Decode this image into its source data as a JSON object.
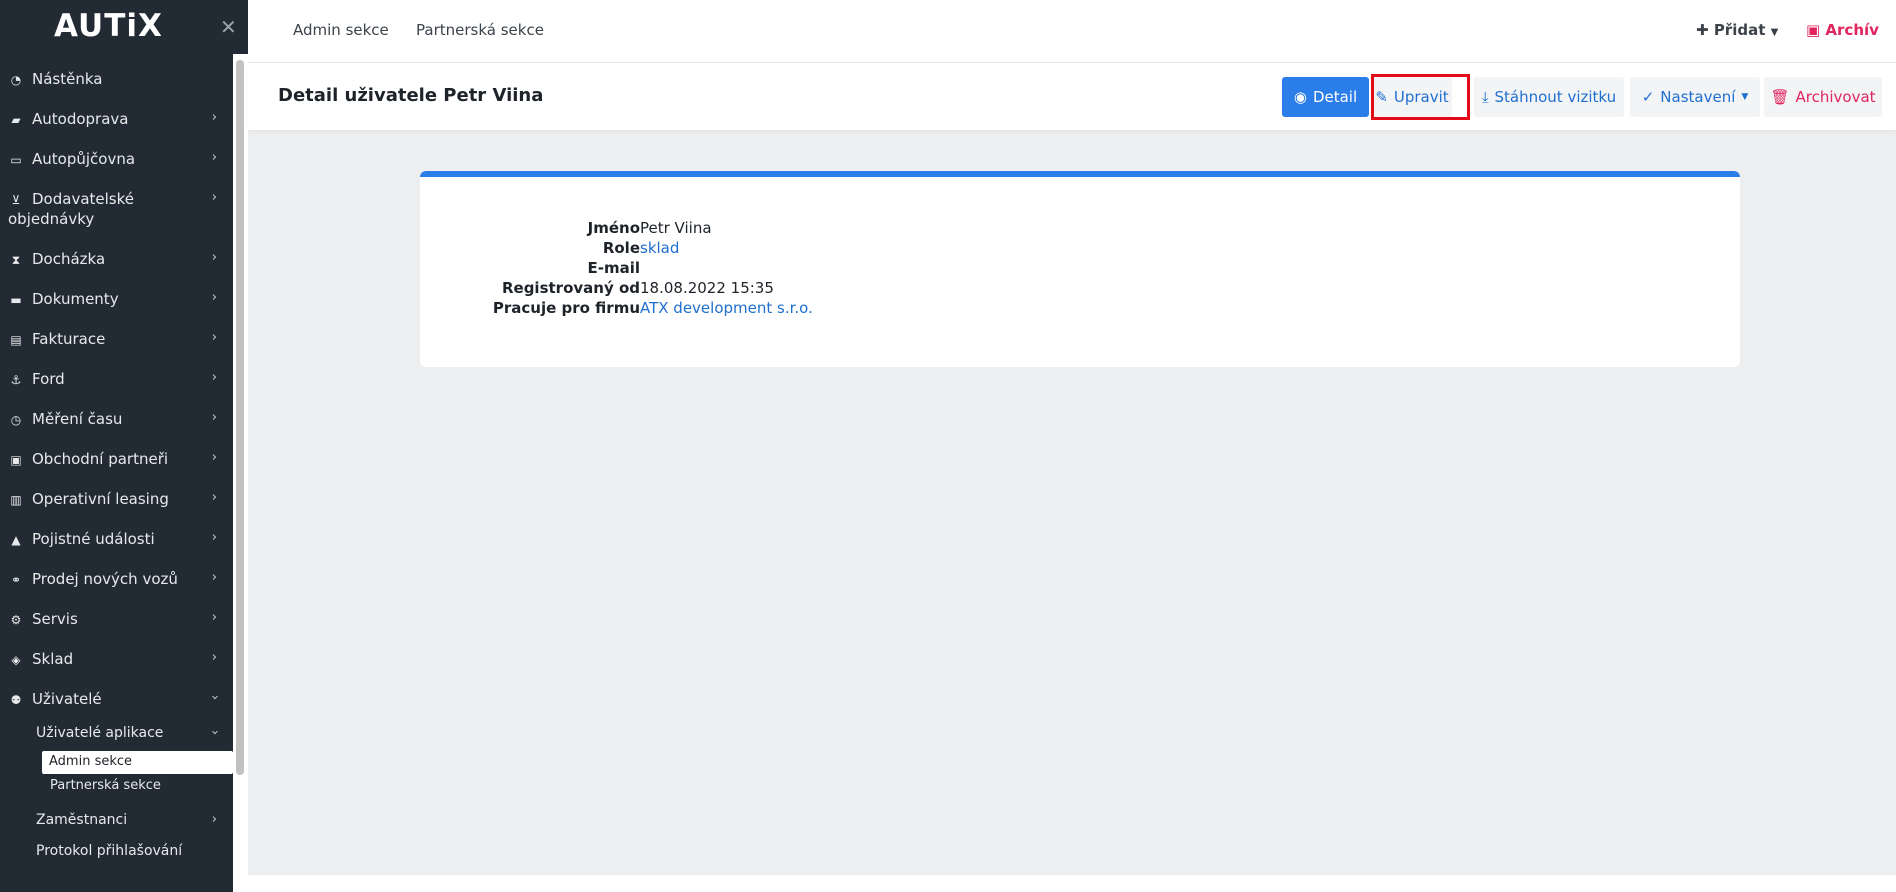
{
  "app": {
    "logo": "AUTiX"
  },
  "topnav": {
    "links": [
      "Admin sekce",
      "Partnerská sekce"
    ],
    "add_label": "Přidat",
    "archive_label": "Archív"
  },
  "header": {
    "title": "Detail uživatele Petr Viina",
    "buttons": {
      "detail": "Detail",
      "edit": "Upravit",
      "download": "Stáhnout vizitku",
      "settings": "Nastavení",
      "archive": "Archivovat"
    }
  },
  "sidebar": {
    "items": [
      {
        "label": "Nástěnka",
        "icon": "dashboard-icon",
        "has_children": false
      },
      {
        "label": "Autodoprava",
        "icon": "truck-icon",
        "has_children": true
      },
      {
        "label": "Autopůjčovna",
        "icon": "car-icon",
        "has_children": true
      },
      {
        "label": "Dodavatelské",
        "label2": "objednávky",
        "icon": "cart-icon",
        "has_children": true
      },
      {
        "label": "Docházka",
        "icon": "hourglass-icon",
        "has_children": true
      },
      {
        "label": "Dokumenty",
        "icon": "folder-icon",
        "has_children": true
      },
      {
        "label": "Fakturace",
        "icon": "invoice-icon",
        "has_children": true
      },
      {
        "label": "Ford",
        "icon": "anchor-icon",
        "has_children": true
      },
      {
        "label": "Měření času",
        "icon": "clock-icon",
        "has_children": true
      },
      {
        "label": "Obchodní partneři",
        "icon": "partners-icon",
        "has_children": true
      },
      {
        "label": "Operativní leasing",
        "icon": "book-icon",
        "has_children": true
      },
      {
        "label": "Pojistné události",
        "icon": "warning-icon",
        "has_children": true
      },
      {
        "label": "Prodej nových vozů",
        "icon": "handshake-icon",
        "has_children": true
      },
      {
        "label": "Servis",
        "icon": "cogs-icon",
        "has_children": true
      },
      {
        "label": "Sklad",
        "icon": "box-icon",
        "has_children": true
      },
      {
        "label": "Uživatelé",
        "icon": "users-icon",
        "has_children": true,
        "expanded": true
      }
    ],
    "users_sub": {
      "group_label": "Uživatelé aplikace",
      "children": [
        "Admin sekce",
        "Partnerská sekce"
      ],
      "active_child": "Admin sekce",
      "employees": "Zaměstnanci",
      "login_protocol": "Protokol přihlašování"
    }
  },
  "detail": {
    "fields": [
      {
        "label": "Jméno",
        "value": "Petr Viina",
        "link": false
      },
      {
        "label": "Role",
        "value": "sklad",
        "link": true
      },
      {
        "label": "E-mail",
        "value": "",
        "link": false
      },
      {
        "label": "Registrovaný od",
        "value": "18.08.2022 15:35",
        "link": false
      },
      {
        "label": "Pracuje pro firmu",
        "value": "ATX development s.r.o.",
        "link": true
      }
    ]
  },
  "colors": {
    "sidebar_bg": "#222b33",
    "accent": "#2b7de9",
    "danger": "#e0245e",
    "highlight": "#e30b17"
  }
}
